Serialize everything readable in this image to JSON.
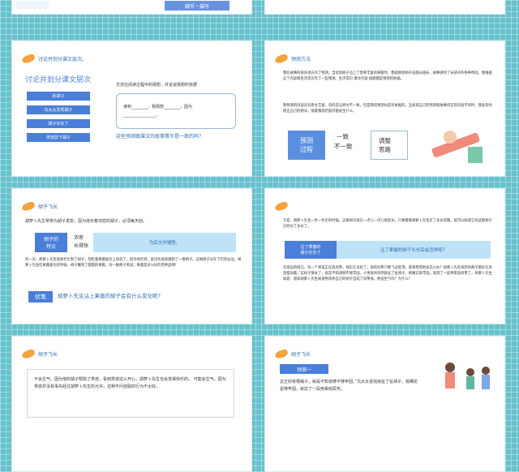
{
  "top": {
    "left_label": "细节・描写",
    "accent": "#4a7ed8"
  },
  "slide1": {
    "header": "讨论并划分课文层次。",
    "title": "讨论并划分课文层次",
    "buttons": [
      "别胡子",
      "鸟太太发现胡子",
      "胡子长长了",
      "男孩剪下胡子"
    ],
    "prompt": "交流在阅读过程中的猜想，并说说猜想的依据",
    "box_line1": "读到________，我猜想________，因为",
    "box_line2": "________________。",
    "question": "这些预测跟课文的故事情节是一致的吗？"
  },
  "slide2": {
    "header": "预测方法",
    "para1": "我在故事的很多地方作了预测。当读到胡子沾上了营养丰富的果酱时，我就猜到胡子会越长越长，故事讲到了长胡子的各种用处，我根据这个内容和生活常识作了一些预测。生活常识 课文内容 插图都是预测的依据。",
    "para2": "我预测的内容没有原文丰富，有的还与原文不一致，但是我的预测也是有依据的。当发现自己的预测和故事的实际内容不同时，我会及时修正自己的想法，接着猜测后面可能发生什么。",
    "box_left": "预测\n过程",
    "mid_line1": "一致",
    "mid_line2": "不一致",
    "box_right": "调整\n思路"
  },
  "slide3": {
    "header": "胡子飞长",
    "intro": "胡萝卜先生常常为胡子发愁，因为他长着浓密的胡子，必须每天刮。",
    "feature_label": "胡子的\n特点",
    "feature_value": "浓密\n长得快",
    "side_note": "为后文作铺垫。",
    "para": "有一天，胡萝卜先生匆匆忙忙刮了胡子，刮吃着果酱面包上班去了。因为他迟到，就没有发现漏刮了一根胡子。这根胡子长在下巴的右边，胡萝卜先生吃果酱面包的时候，胡子蘸到了甜甜的果酱，对一根胡子来说，果酱是多么好的营养品啊!",
    "footer_tag": "伏笔",
    "footer_question": "胡萝卜先生沾上果酱的胡子会有什么变化呢?"
  },
  "slide4": {
    "intro": "于是，胡萝卜先生一步一步走的时候，这根胡子就在一点儿一点儿地变长。只要看看胡萝卜先生走了多长的路，就可以知道它的这根胡子已经长了多长了。",
    "tag": "沾了果酱的\n胡子长长了",
    "question": "沾了果酱的胡子长长后会怎样呢？",
    "para": "在绕远的街口，有一个男孩正在放风筝。线实在太短了，他的风筝只要飞过屋顶。请来帮帮他该怎么办？胡萝卜先生身旁的胡子刚好在风里摆动着。”这样子够长了，就是不知道够不够牢固。小男孩将突然就扯了扯胡子，绝确实够牢固。就到了一段用来放风筝了。胡萝卜先生如是：假如胡萝卜先生知道男孩将自己的胡子当成了风筝线，他会生气吗？为什么？"
  },
  "slide5": {
    "header": "胡子飞长",
    "para": "不会生气。因为他的胡子帮助了男孩，看到男孩这么开心，胡萝卜先生也会觉得快乐的。 可能会生气。因为男孩并没有事先经过胡萝卜先生的允许，这种不问自取的行为不太好。"
  },
  "slide6": {
    "header": "胡子飞长",
    "tag": "预测一",
    "para": "这正好有根绳子，就是不知道够不够牢固。”鸟太太说完就扯了扯胡子，她确定足够牢固，就剪了一段用来晾尿布。"
  }
}
